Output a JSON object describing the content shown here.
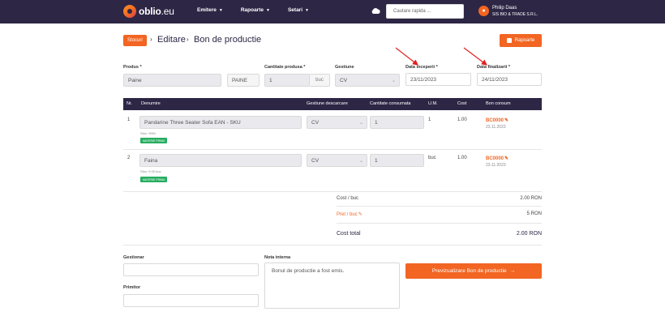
{
  "navbar": {
    "logo_main": "oblio",
    "logo_suffix": ".eu",
    "menu": [
      {
        "label": "Emitere"
      },
      {
        "label": "Rapoarte"
      },
      {
        "label": "Setari"
      }
    ],
    "search_placeholder": "Cautare rapida ...",
    "user_name": "Philip Daas",
    "user_company": "SIS BIO & TRADE S.R.L."
  },
  "breadcrumb": {
    "badge": "Stocuri",
    "items": [
      "Editare",
      "Bon de productie"
    ]
  },
  "rapoarte_button": "Rapoarte",
  "form": {
    "produs_label": "Produs *",
    "produs_value": "Paine",
    "produs_code": "PAINE",
    "cantitate_label": "Cantitate produsa *",
    "cantitate_value": "1",
    "cantitate_unit": "buc",
    "gestiune_label": "Gestiune",
    "gestiune_value": "CV",
    "data_inceput_label": "Data inceperii *",
    "data_inceput_value": "23/11/2023",
    "data_final_label": "Data finalizarii *",
    "data_final_value": "24/11/2023"
  },
  "table": {
    "headers": [
      "Nr.",
      "Denumire",
      "Gestiune descarcare",
      "Cantitate consumata",
      "U.M.",
      "Cost",
      "Bon consum"
    ],
    "rows": [
      {
        "nr": "1",
        "denumire": "Pandarine Three Seater Sofa EAN - SKU",
        "sub": "Stoc: 9991",
        "tag": "MATERIE PRIMA",
        "gestiune": "CV",
        "cantitate": "1",
        "um": "1",
        "cost": "1.00",
        "bon": "BC0000",
        "bon_date": "23.11.2023"
      },
      {
        "nr": "2",
        "denumire": "Faina",
        "sub": "Stoc: 9.00 buc",
        "tag": "MATERIE PRIMA",
        "gestiune": "CV",
        "cantitate": "1",
        "um": "buc",
        "cost": "1.00",
        "bon": "BC0000",
        "bon_date": "23.11.2023"
      }
    ]
  },
  "totals": {
    "cost_label": "Cost / buc",
    "cost_value": "2.00 RON",
    "pret_label": "Pret / buc",
    "pret_value": "5 RON",
    "total_label": "Cost total",
    "total_value": "2.00 RON"
  },
  "bottom": {
    "gestionar_label": "Gestionar",
    "primitor_label": "Primitor",
    "nota_label": "Nota interna",
    "nota_value": "Bonul de productie a fost emis.",
    "preview_button": "Previzualizare Bon de productie"
  },
  "colors": {
    "navbar": "#2d2645",
    "accent": "#f26522",
    "tag": "#27ae60",
    "arrow": "#e02020"
  }
}
